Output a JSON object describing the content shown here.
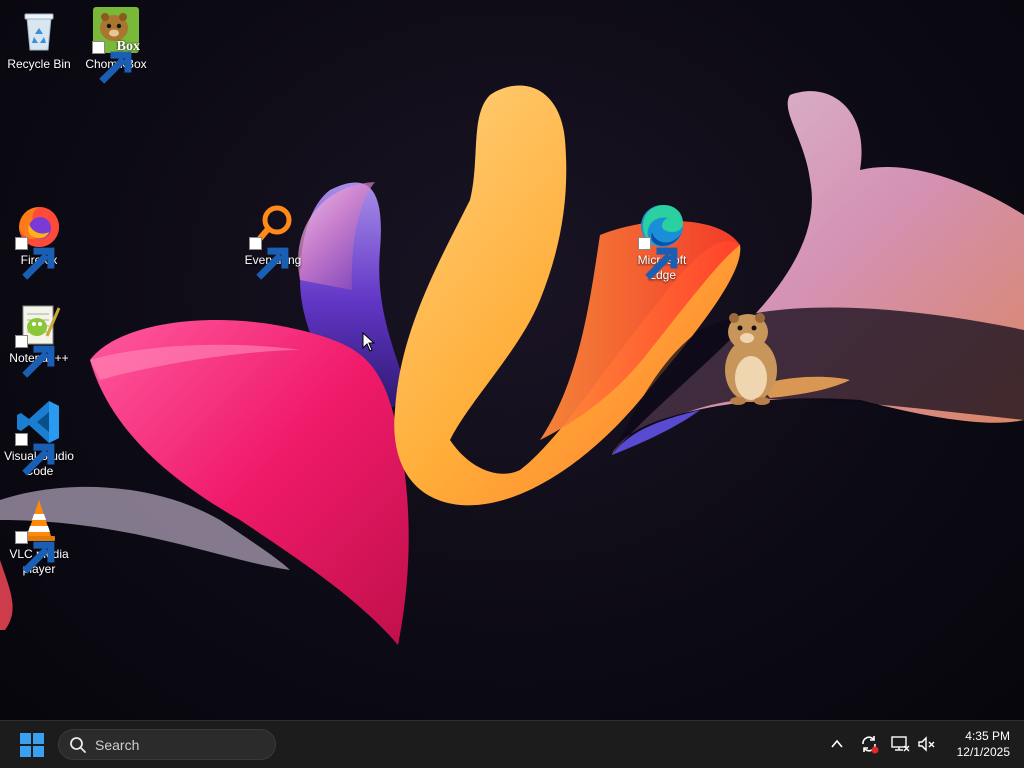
{
  "desktop": {
    "icons": [
      {
        "label": "Recycle Bin",
        "icon": "recycle-bin-icon"
      },
      {
        "label": "ChomikBox",
        "icon": "chomikbox-icon",
        "badge": "Box"
      },
      {
        "label": "Firefox",
        "icon": "firefox-icon"
      },
      {
        "label": "Everything",
        "icon": "everything-search-icon"
      },
      {
        "label": "Microsoft Edge",
        "icon": "edge-icon"
      },
      {
        "label": "Notepad++",
        "icon": "notepadpp-icon"
      },
      {
        "label": "Visual Studio Code",
        "icon": "vscode-icon"
      },
      {
        "label": "VLC media player",
        "icon": "vlc-icon"
      }
    ]
  },
  "taskbar": {
    "start_icon": "windows-start-icon",
    "search_placeholder": "Search",
    "tray": {
      "chevron_icon": "chevron-up-icon",
      "sync_icon": "sync-error-icon",
      "network_icon": "network-disconnected-icon",
      "volume_icon": "volume-muted-icon"
    },
    "clock": {
      "time": "4:35 PM",
      "date": "12/1/2025"
    }
  },
  "colors": {
    "taskbar_bg": "#1c1c1c",
    "search_bg": "#2b2b2b",
    "start_blue": "#3aa0f0"
  }
}
